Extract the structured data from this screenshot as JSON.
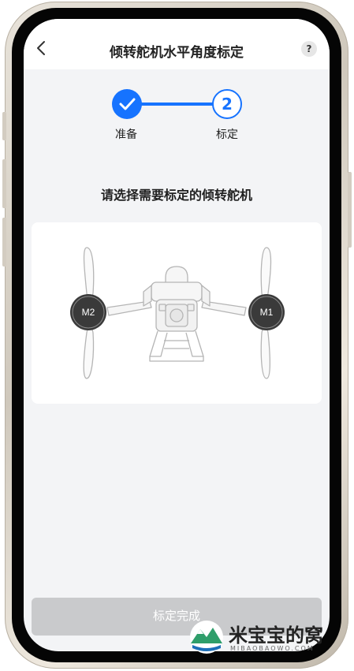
{
  "nav": {
    "title": "倾转舵机水平角度标定",
    "help_label": "?"
  },
  "steps": [
    {
      "label": "准备",
      "state": "done"
    },
    {
      "label": "标定",
      "number": "2",
      "state": "active"
    }
  ],
  "prompt": "请选择需要标定的倾转舵机",
  "motors": {
    "left": "M2",
    "right": "M1"
  },
  "finish_button": "标定完成",
  "watermark": {
    "text": "米宝宝的窝",
    "subtitle": "MIBAOBAOWO.COM"
  },
  "colors": {
    "accent": "#1673ff",
    "button_disabled": "#c9cacc",
    "background": "#f3f4f6"
  }
}
